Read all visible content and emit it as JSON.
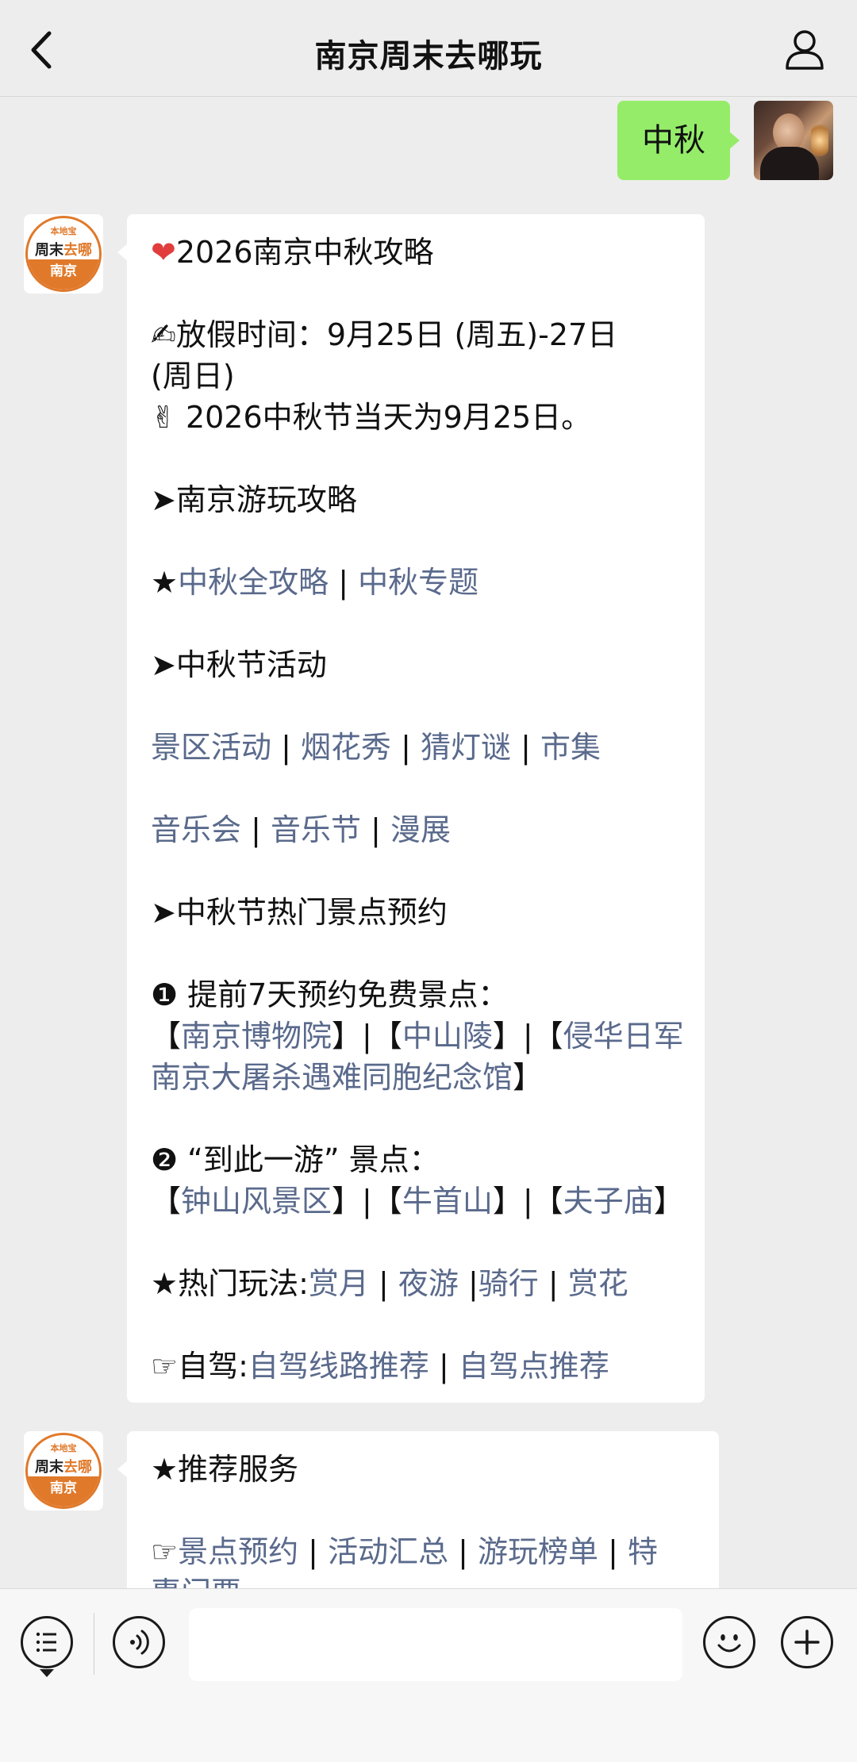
{
  "header": {
    "title": "南京周末去哪玩"
  },
  "user_message": {
    "text": "中秋"
  },
  "bot_avatar": {
    "brand_top": "本地宝",
    "brand_main_a": "周末",
    "brand_main_b": "去哪",
    "brand_city": "南京"
  },
  "message1": {
    "heading": "2026南京中秋攻略",
    "holiday_label": "放假时间：9月25日 (周五)-27日",
    "holiday_cont": "(周日)",
    "festival_day": "2026中秋节当天为9月25日。",
    "section1": "➤南京游玩攻略",
    "star1": "★",
    "link_all": "中秋全攻略",
    "sep": "|",
    "link_topic": "中秋专题",
    "section2": "➤中秋节活动",
    "act_links_1": [
      "景区活动",
      "烟花秀",
      "猜灯谜",
      "市集"
    ],
    "act_links_2": [
      "音乐会",
      "音乐节",
      "漫展"
    ],
    "section3": "➤中秋节热门景点预约",
    "item1_num": "❶",
    "item1_label": "提前7天预约免费景点：",
    "item1_link_a": "南京博物院",
    "item1_link_b": "中山陵",
    "item1_link_c1": "侵华日军",
    "item1_link_c2": "南京大屠杀遇难同胞纪念馆",
    "item2_num": "❷",
    "item2_label": "“到此一游” 景点：",
    "item2_link_a": "钟山风景区",
    "item2_link_b": "牛首山",
    "item2_link_c": "夫子庙",
    "hot_label": "★热门玩法:",
    "hot_links": [
      "赏月",
      "夜游",
      "骑行",
      "赏花"
    ],
    "drive_label": "☞自驾:",
    "drive_link_a": "自驾线路推荐",
    "drive_link_b": "自驾点推荐"
  },
  "message2": {
    "heading": "★推荐服务",
    "service_prefix": "☞",
    "service_links": [
      "景点预约",
      "活动汇总",
      "游玩榜单",
      "特"
    ],
    "cut_line": "惠门票"
  },
  "colors": {
    "link": "#5a6a8c",
    "my_bubble": "#95ec69",
    "brand_orange": "#e0792a",
    "background": "#ededed"
  },
  "icons": {
    "back": "chevron-left-icon",
    "profile": "person-icon",
    "menu": "list-menu-icon",
    "voice": "voice-icon",
    "emoji": "smiley-icon",
    "plus": "plus-icon"
  }
}
